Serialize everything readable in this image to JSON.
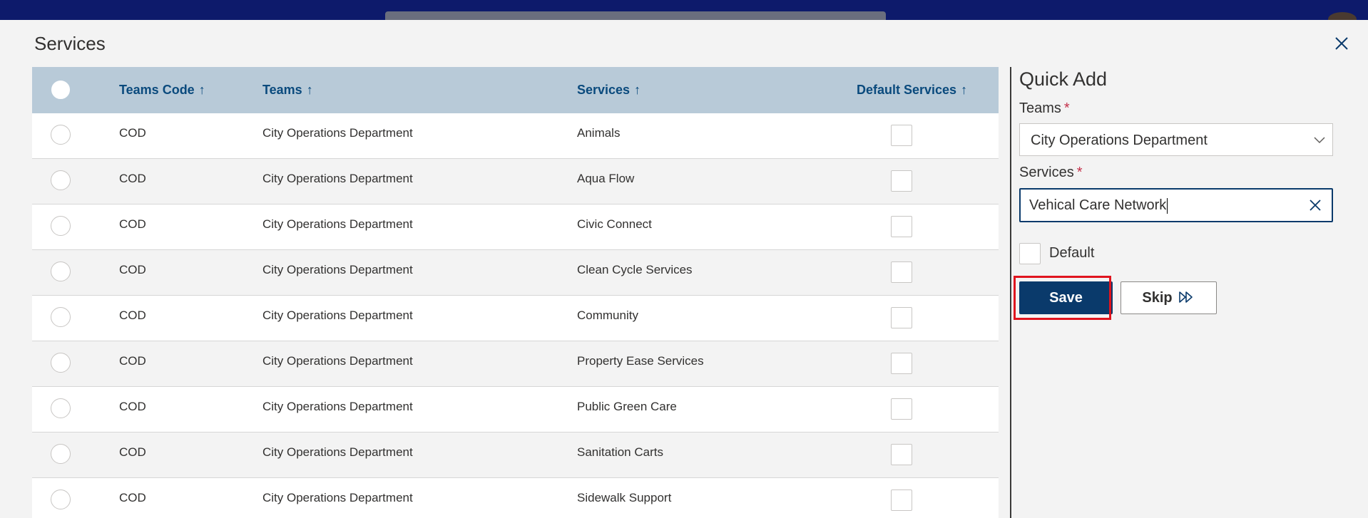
{
  "dialog": {
    "title": "Services"
  },
  "table": {
    "headers": {
      "teams_code": "Teams Code",
      "teams": "Teams",
      "services": "Services",
      "default_services": "Default Services",
      "sort_glyph": "↑"
    },
    "rows": [
      {
        "code": "COD",
        "team": "City Operations Department",
        "service": "Animals",
        "default": false
      },
      {
        "code": "COD",
        "team": "City Operations Department",
        "service": "Aqua Flow",
        "default": false
      },
      {
        "code": "COD",
        "team": "City Operations Department",
        "service": "Civic Connect",
        "default": false
      },
      {
        "code": "COD",
        "team": "City Operations Department",
        "service": "Clean Cycle Services",
        "default": false
      },
      {
        "code": "COD",
        "team": "City Operations Department",
        "service": "Community",
        "default": false
      },
      {
        "code": "COD",
        "team": "City Operations Department",
        "service": "Property Ease Services",
        "default": false
      },
      {
        "code": "COD",
        "team": "City Operations Department",
        "service": "Public Green Care",
        "default": false
      },
      {
        "code": "COD",
        "team": "City Operations Department",
        "service": "Sanitation Carts",
        "default": false
      },
      {
        "code": "COD",
        "team": "City Operations Department",
        "service": "Sidewalk Support",
        "default": false
      }
    ]
  },
  "quick_add": {
    "title": "Quick Add",
    "teams_label": "Teams",
    "teams_value": "City Operations Department",
    "services_label": "Services",
    "services_value": "Vehical Care Network",
    "required_mark": "*",
    "default_label": "Default",
    "default_checked": false,
    "save_label": "Save",
    "skip_label": "Skip"
  },
  "colors": {
    "topbar": "#0d1a6b",
    "header_bg": "#b8cad8",
    "header_text": "#0a4a7d",
    "primary": "#0a3a6b",
    "required": "#c4314b",
    "highlight": "#e0141e"
  },
  "icons": {
    "close": "close-icon",
    "chevron": "chevron-down-icon",
    "clear": "clear-icon",
    "skip": "fast-forward-icon"
  }
}
